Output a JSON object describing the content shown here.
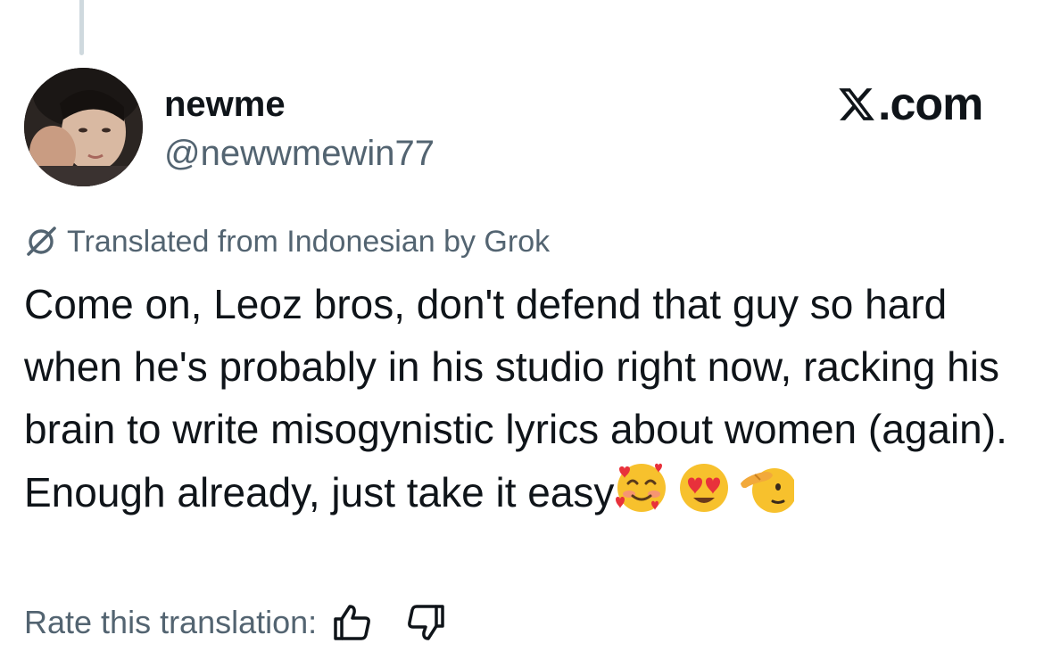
{
  "author": {
    "display_name": "newme",
    "handle": "@newwmewin77"
  },
  "brand": {
    "text": ".com",
    "icon": "x-logo-icon"
  },
  "translation": {
    "label": "Translated from Indonesian by Grok",
    "icon": "grok-icon"
  },
  "tweet": {
    "text": "Come on, Leoz bros, don't defend that guy so hard when he's probably in his studio right now, racking his brain to write misogynistic lyrics about women (again). Enough already, just take it easy",
    "emojis": [
      "smiling-face-with-hearts-icon",
      "heart-eyes-icon",
      "saluting-face-icon"
    ]
  },
  "rating": {
    "label": "Rate this translation:",
    "up_icon": "thumbs-up-icon",
    "down_icon": "thumbs-down-icon"
  },
  "colors": {
    "text_primary": "#0f1419",
    "text_secondary": "#536471",
    "thread_line": "#cfd9de",
    "background": "#ffffff"
  }
}
